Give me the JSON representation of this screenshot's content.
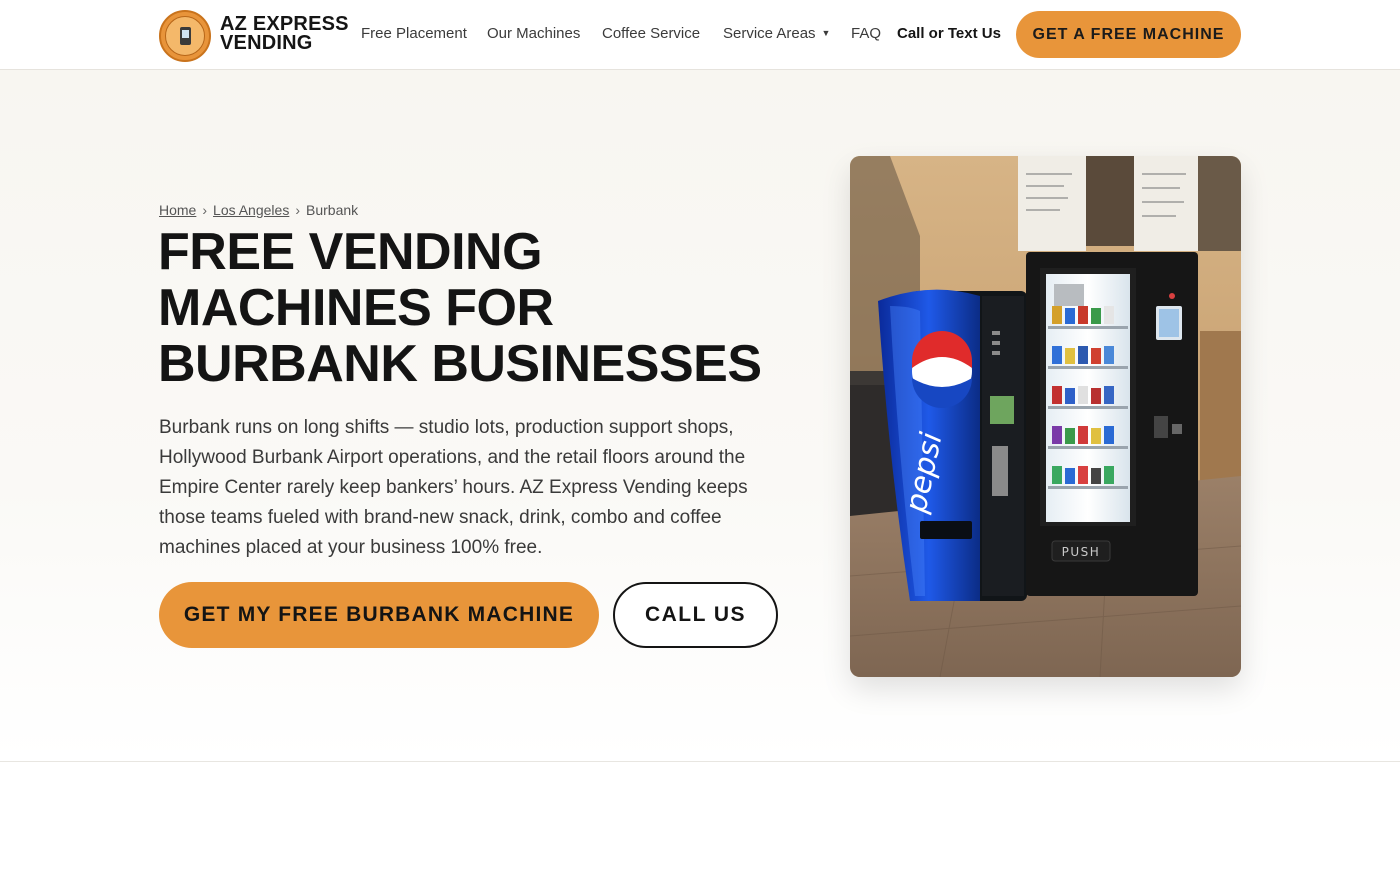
{
  "header": {
    "brand_line1": "AZ EXPRESS",
    "brand_line2": "VENDING",
    "nav": {
      "free_placement": "Free Placement",
      "our_machines": "Our Machines",
      "coffee_service": "Coffee Service",
      "service_areas": "Service Areas",
      "faq": "FAQ",
      "call_or_text": "Call or Text Us"
    },
    "cta": "GET A FREE MACHINE"
  },
  "hero": {
    "breadcrumb": {
      "home": "Home",
      "separator": "›",
      "los_angeles": "Los Angeles",
      "current": "Burbank"
    },
    "headline_line1": "FREE VENDING",
    "headline_line2": "MACHINES FOR",
    "headline_line3": "BURBANK BUSINESSES",
    "body": "Burbank runs on long shifts — studio lots, production support shops, Hollywood Burbank Airport operations, and the retail floors around the Empire Center rarely keep bankers’ hours. AZ Express Vending keeps those teams fueled with brand-new snack, drink, combo and coffee machines placed at your business 100% free.",
    "primary_button": "GET MY FREE BURBANK MACHINE",
    "secondary_button": "CALL US",
    "photo": {
      "machine_brand": "pepsi",
      "push_label": "PUSH"
    }
  },
  "colors": {
    "accent": "#e8953a",
    "text_dark": "#141414",
    "hero_bg": "#f8f6f1"
  }
}
